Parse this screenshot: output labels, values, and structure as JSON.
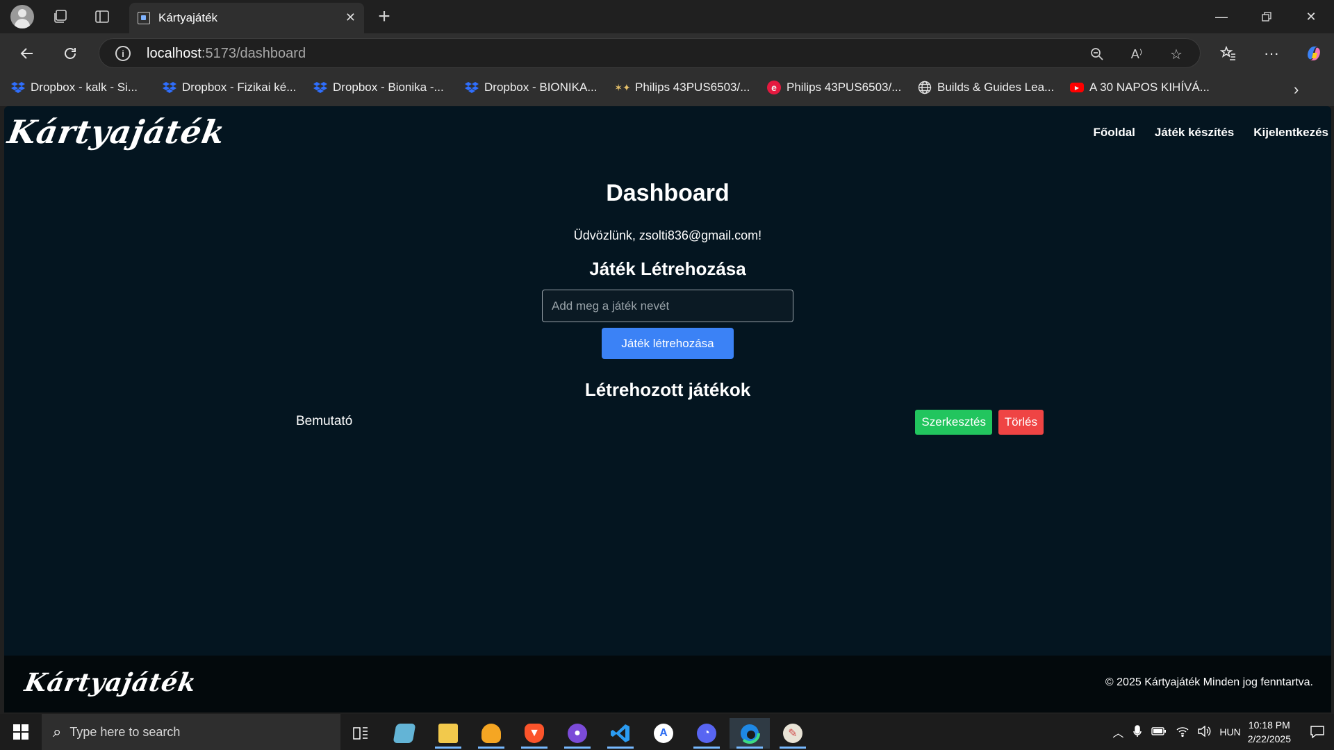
{
  "browser": {
    "tab_title": "Kártyajáték",
    "url_host": "localhost",
    "url_path": ":5173/dashboard",
    "bookmarks": [
      "Dropbox - kalk - Si...",
      "Dropbox - Fizikai ké...",
      "Dropbox - Bionika -...",
      "Dropbox - BIONIKA...",
      "Philips 43PUS6503/...",
      "Philips 43PUS6503/...",
      "Builds & Guides Lea...",
      "A 30 NAPOS KIHÍVÁ..."
    ]
  },
  "site": {
    "logo": "Kártyajáték",
    "nav": [
      "Főoldal",
      "Játék készítés",
      "Kijelentkezés"
    ],
    "title": "Dashboard",
    "welcome": "Üdvözlünk, zsolti836@gmail.com!",
    "create_heading": "Játék Létrehozása",
    "input_placeholder": "Add meg a játék nevét",
    "create_button": "Játék létrehozása",
    "list_heading": "Létrehozott játékok",
    "games": [
      {
        "name": "Bemutató",
        "edit": "Szerkesztés",
        "delete": "Törlés"
      }
    ],
    "footer_logo": "Kártyajáték",
    "footer_copy": "© 2025 Kártyajáték Minden jog fenntartva."
  },
  "taskbar": {
    "search_placeholder": "Type here to search",
    "language": "HUN",
    "time": "10:18 PM",
    "date": "2/22/2025",
    "apps": [
      "task-view",
      "notepad",
      "file-explorer",
      "app-orange",
      "brave",
      "github-desktop",
      "vscode",
      "app-a",
      "app-discord",
      "edge",
      "paint"
    ]
  },
  "colors": {
    "page_bg": "#041520",
    "primary": "#3b82f6",
    "edit": "#22c55e",
    "delete": "#ef4444"
  }
}
